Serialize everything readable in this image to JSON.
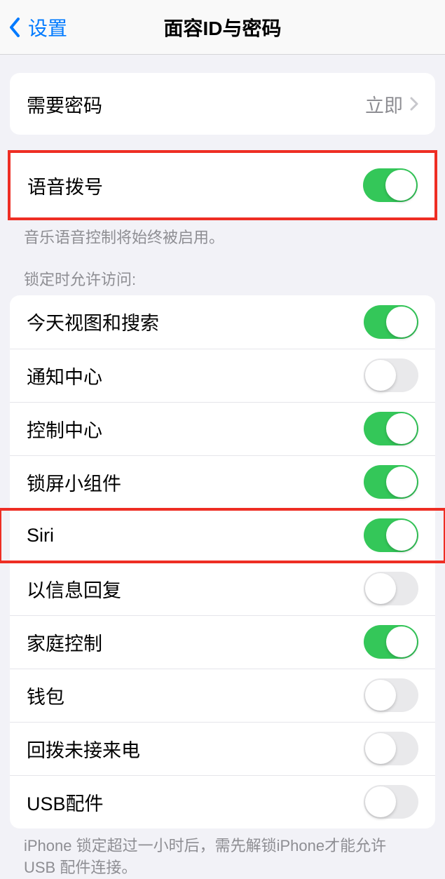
{
  "nav": {
    "back_label": "设置",
    "title": "面容ID与密码"
  },
  "passcode_row": {
    "label": "需要密码",
    "value": "立即"
  },
  "voice_dial": {
    "label": "语音拨号",
    "on": true
  },
  "voice_dial_footer": "音乐语音控制将始终被启用。",
  "lock_access_header": "锁定时允许访问:",
  "lock_items": [
    {
      "label": "今天视图和搜索",
      "on": true
    },
    {
      "label": "通知中心",
      "on": false
    },
    {
      "label": "控制中心",
      "on": true
    },
    {
      "label": "锁屏小组件",
      "on": true
    },
    {
      "label": "Siri",
      "on": true,
      "highlighted": true
    },
    {
      "label": "以信息回复",
      "on": false
    },
    {
      "label": "家庭控制",
      "on": true
    },
    {
      "label": "钱包",
      "on": false
    },
    {
      "label": "回拨未接来电",
      "on": false
    },
    {
      "label": "USB配件",
      "on": false
    }
  ],
  "usb_footer": "iPhone 锁定超过一小时后，需先解锁iPhone才能允许 USB 配件连接。"
}
